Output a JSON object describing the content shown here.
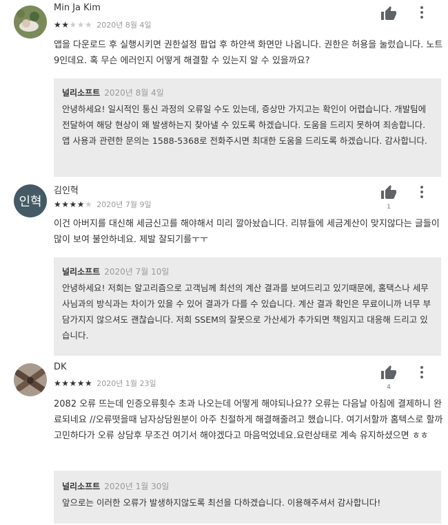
{
  "reviews": [
    {
      "author": "Min Ja Kim",
      "avatar_letters": "",
      "rating": 2,
      "date": "2020년 8월 4일",
      "helpful_count": "",
      "text": "앱을 다운로드 후 실행시키면 권한설정 팝업 후 하얀색 화면만 나옵니다. 권한은 허용을 눌렀습니다. 노트9인데요. 혹 무슨 에러인지 어떻게 해결할 수 있는지 알 수 있을까요?",
      "reply": {
        "author": "널리소프트",
        "date": "2020년 8월 4일",
        "text": "안녕하세요! 일시적인 통신 과정의 오류일 수도 있는데, 증상만 가지고는 확인이 어렵습니다. 개발팀에 전달하여 해당 현상이 왜 발생하는지 찾아낼 수 있도록 하겠습니다. 도움을 드리지 못하여 죄송합니다. 앱 사용과 관련한 문의는 1588-5368로 전화주시면 최대한 도움을 드리도록 하겠습니다. 감사합니다."
      }
    },
    {
      "author": "김인혁",
      "avatar_letters": "인혁",
      "rating": 4,
      "date": "2020년 7월 9일",
      "helpful_count": "1",
      "text": "이건 아버지를 대신해 세금신고를 해야해서 미리 깔아놨습니다. 리뷰들에 세금계산이 맞지않다는 글들이 많이 보여 불안하네요. 제발 잘되기를ㅜㅜ",
      "reply": {
        "author": "널리소프트",
        "date": "2020년 7월 10일",
        "text": "안녕하세요! 저희는 알고리즘으로 고객님께 최선의 계산 결과를 보여드리고 있기때문에, 홈택스나 세무사님과의 방식과는 차이가 있을 수 있어 결과가 다를 수 있습니다. 계산 결과 확인은 무료이니까 너무 부담가지지 않으셔도 괜찮습니다. 저희 SSEM의 잘못으로 가산세가 추가되면 책임지고 대응해 드리고 있습니다."
      }
    },
    {
      "author": "DK",
      "avatar_letters": "",
      "rating": 5,
      "date": "2020년 1월 23일",
      "helpful_count": "4",
      "text": "2082 오류 뜨는데 인증오류횟수 초과 나오는데 어떻게 해야되나요?? 오류는 다음날 아침에 결제하니 완료되네요 //오류떳을때 남자상담원분이 아주 친절하게 해결해줄려고 했습니다. 여기서할까 홈텍스로 할까 고민하다가 오류 상담후 무조건 여기서 해야겠다고 마음먹었네요.요런상태로 계속 유지하셨으면 ㅎㅎ",
      "reply": {
        "author": "널리소프트",
        "date": "2020년 1월 30일",
        "text": "앞으로는 이러한 오류가 발생하지않도록 최선을 다하겠습니다. 이용해주셔서 감사합니다!"
      }
    }
  ],
  "icons": {
    "helpful": "thumb-up-icon",
    "more": "more-vert-icon"
  },
  "colors": {
    "reply_background": "#ebebeb",
    "star_on": "#333333",
    "star_off": "#cccccc",
    "avatar_letters_bg": "#455a64"
  }
}
